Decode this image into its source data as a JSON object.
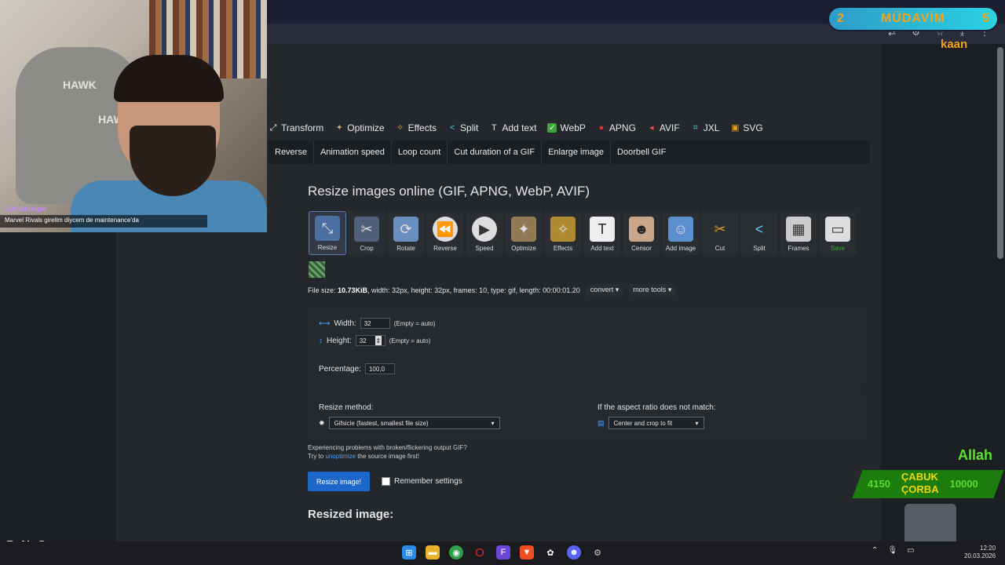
{
  "stream": {
    "badge_left": "2",
    "badge_title": "MÜDAVİM",
    "badge_right": "5",
    "badge_user": "kaan",
    "chat_user": "QAOSbringer",
    "chat_message": "Marvel Rivals girelim diycem de maintenance'da",
    "chair_logo": "HAWK",
    "overlay_allah": "Allah",
    "corba_left": "4150",
    "corba_line1": "ÇABUK",
    "corba_line2": "ÇORBA",
    "corba_right": "10000",
    "brand": "ByNoGame"
  },
  "nav": {
    "main": [
      {
        "label": "Transform",
        "icon": "transform-icon"
      },
      {
        "label": "Optimize",
        "icon": "optimize-icon"
      },
      {
        "label": "Effects",
        "icon": "effects-icon"
      },
      {
        "label": "Split",
        "icon": "split-icon"
      },
      {
        "label": "Add text",
        "icon": "add-text-icon"
      },
      {
        "label": "WebP",
        "icon": "webp-icon"
      },
      {
        "label": "APNG",
        "icon": "apng-icon"
      },
      {
        "label": "AVIF",
        "icon": "avif-icon"
      },
      {
        "label": "JXL",
        "icon": "jxl-icon"
      },
      {
        "label": "SVG",
        "icon": "svg-icon"
      }
    ],
    "sub": [
      "Reverse",
      "Animation speed",
      "Loop count",
      "Cut duration of a GIF",
      "Enlarge image",
      "Doorbell GIF"
    ]
  },
  "page": {
    "title": "Resize images online (GIF, APNG, WebP, AVIF)",
    "tools": [
      {
        "label": "Resize",
        "icon": "resize-icon"
      },
      {
        "label": "Crop",
        "icon": "crop-icon"
      },
      {
        "label": "Rotate",
        "icon": "rotate-icon"
      },
      {
        "label": "Reverse",
        "icon": "reverse-icon"
      },
      {
        "label": "Speed",
        "icon": "speed-icon"
      },
      {
        "label": "Optimize",
        "icon": "optimize-icon"
      },
      {
        "label": "Effects",
        "icon": "effects-icon"
      },
      {
        "label": "Add text",
        "icon": "add-text-icon"
      },
      {
        "label": "Censor",
        "icon": "censor-icon"
      },
      {
        "label": "Add image",
        "icon": "add-image-icon"
      },
      {
        "label": "Cut",
        "icon": "scissors-icon"
      },
      {
        "label": "Split",
        "icon": "split-icon"
      },
      {
        "label": "Frames",
        "icon": "frames-icon"
      },
      {
        "label": "Save",
        "icon": "save-icon"
      }
    ],
    "file_info_prefix": "File size: ",
    "file_size": "10.73KiB",
    "file_info_rest": ", width: 32px, height: 32px, frames: 10, type: gif, length: 00:00:01.20",
    "convert": "convert",
    "more_tools": "more tools",
    "width_label": "Width:",
    "width_value": "32",
    "height_label": "Height:",
    "height_value": "32",
    "empty_hint": "(Empty = auto)",
    "percentage_label": "Percentage:",
    "percentage_value": "100,0",
    "resize_method_label": "Resize method:",
    "resize_method_value": "Gifsicle (fastest, smallest file size)",
    "aspect_label": "If the aspect ratio does not match:",
    "aspect_value": "Center and crop to fit",
    "warn_line1": "Experiencing problems with broken/flickering output GIF?",
    "warn_try": "Try to ",
    "warn_link": "unoptimize",
    "warn_rest": " the source image first!",
    "resize_button": "Resize image!",
    "remember": "Remember settings",
    "resized_heading": "Resized image:"
  },
  "taskbar": {
    "time": "12:20",
    "date": "20.03.2026"
  },
  "colors": {
    "accent": "#1e66c9",
    "link": "#4aa3ff",
    "badge": "#f2a31b",
    "green": "#5bdc2f"
  }
}
